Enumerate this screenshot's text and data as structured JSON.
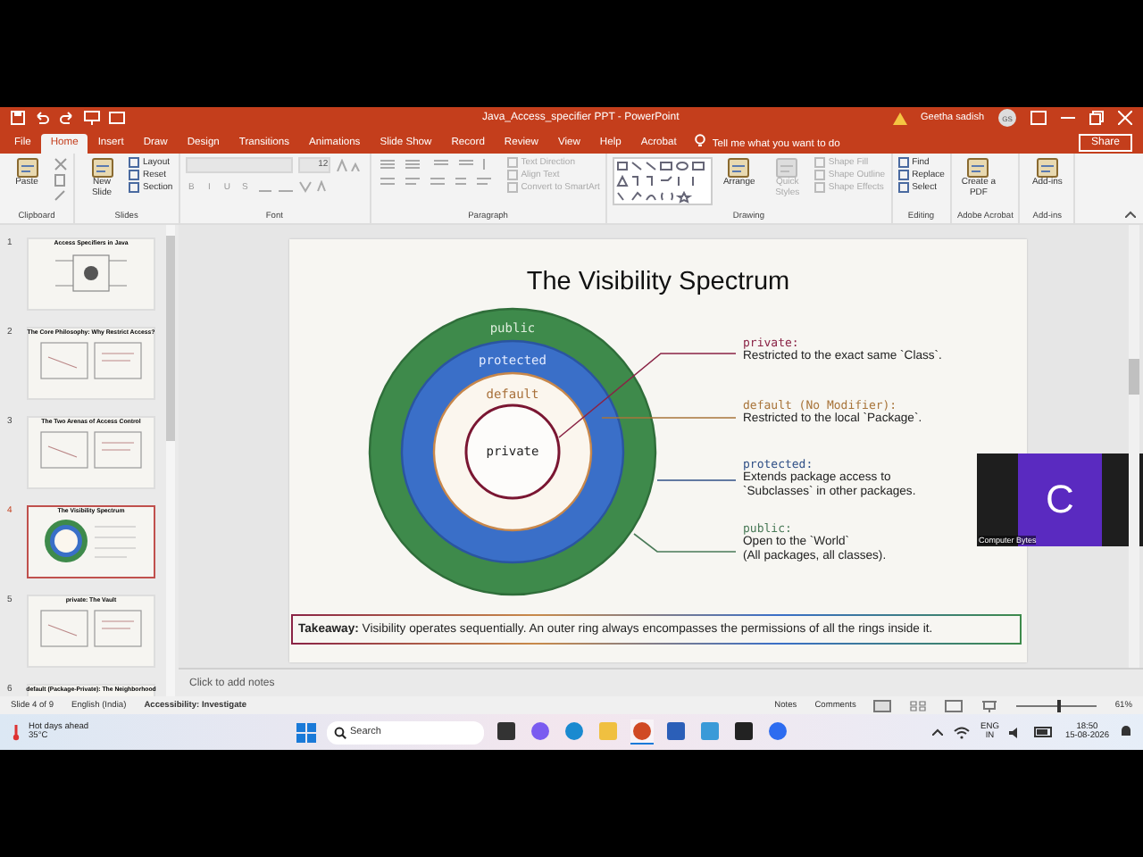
{
  "window": {
    "title": "Java_Access_specifier PPT  -  PowerPoint",
    "user": "Geetha sadish",
    "avatar": "GS"
  },
  "ribbon_tabs": [
    {
      "label": "File",
      "selected": false
    },
    {
      "label": "Home",
      "selected": true
    },
    {
      "label": "Insert",
      "selected": false
    },
    {
      "label": "Draw",
      "selected": false
    },
    {
      "label": "Design",
      "selected": false
    },
    {
      "label": "Transitions",
      "selected": false
    },
    {
      "label": "Animations",
      "selected": false
    },
    {
      "label": "Slide Show",
      "selected": false
    },
    {
      "label": "Record",
      "selected": false
    },
    {
      "label": "Review",
      "selected": false
    },
    {
      "label": "View",
      "selected": false
    },
    {
      "label": "Help",
      "selected": false
    },
    {
      "label": "Acrobat",
      "selected": false
    }
  ],
  "tell_me": {
    "placeholder": "Tell me what you want to do"
  },
  "share_button": "Share",
  "ribbon_groups": [
    {
      "label": "Clipboard",
      "items": [
        {
          "kind": "large",
          "label": "Paste",
          "disabled": false
        },
        {
          "kind": "clip-tools"
        }
      ]
    },
    {
      "label": "Slides",
      "items": [
        {
          "kind": "large",
          "label": "New Slide",
          "disabled": false
        },
        {
          "kind": "small",
          "labels": [
            "Layout",
            "Reset",
            "Section"
          ],
          "disabled": false
        }
      ]
    },
    {
      "label": "Font",
      "items": [
        {
          "kind": "font-tools",
          "size": "12",
          "format": [
            "B",
            "I",
            "U",
            "S"
          ]
        }
      ]
    },
    {
      "label": "Paragraph",
      "items": [
        {
          "kind": "para-tools"
        },
        {
          "kind": "small",
          "labels": [
            "Text Direction",
            "Align Text",
            "Convert to SmartArt"
          ],
          "disabled": true
        }
      ]
    },
    {
      "label": "Drawing",
      "items": [
        {
          "kind": "shapes"
        },
        {
          "kind": "large",
          "label": "Arrange",
          "disabled": false
        },
        {
          "kind": "large",
          "label": "Quick Styles",
          "disabled": true
        },
        {
          "kind": "small",
          "labels": [
            "Shape Fill",
            "Shape Outline",
            "Shape Effects"
          ],
          "disabled": true
        }
      ]
    },
    {
      "label": "Editing",
      "items": [
        {
          "kind": "small",
          "labels": [
            "Find",
            "Replace",
            "Select"
          ],
          "disabled": false
        }
      ]
    },
    {
      "label": "Adobe Acrobat",
      "items": [
        {
          "kind": "large",
          "label": "Create a PDF",
          "disabled": false
        }
      ]
    },
    {
      "label": "Add-ins",
      "items": [
        {
          "kind": "large",
          "label": "Add-ins",
          "disabled": false
        }
      ]
    }
  ],
  "thumbnails": [
    {
      "number": "1",
      "title": "Access Specifiers in Java",
      "kind": "diagram",
      "selected": false
    },
    {
      "number": "2",
      "title": "The Core Philosophy: Why Restrict Access?",
      "kind": "panels",
      "selected": false
    },
    {
      "number": "3",
      "title": "The Two Arenas of Access Control",
      "kind": "panels",
      "selected": false
    },
    {
      "number": "4",
      "title": "The Visibility Spectrum",
      "kind": "rings",
      "selected": true
    },
    {
      "number": "5",
      "title": "private: The Vault",
      "kind": "panels",
      "selected": false
    },
    {
      "number": "6",
      "title": "default (Package-Private): The Neighborhood",
      "kind": "diagram",
      "selected": false
    }
  ],
  "slide": {
    "title": "The Visibility Spectrum",
    "rings": [
      {
        "label": "public",
        "color": "#3e8a4b"
      },
      {
        "label": "protected",
        "color": "#3a6fc8"
      },
      {
        "label": "default",
        "color": "#fbf6ee"
      },
      {
        "label": "private",
        "color": "#fdfcfa"
      }
    ],
    "legend": [
      {
        "keyword": "private:",
        "color": "#8a2345",
        "lines": [
          "Restricted to the exact same `Class`."
        ]
      },
      {
        "keyword": "default (No Modifier):",
        "color": "#a8743a",
        "lines": [
          "Restricted to the local `Package`."
        ]
      },
      {
        "keyword": "protected:",
        "color": "#2f4f86",
        "lines": [
          "Extends package access to",
          "`Subclasses` in other packages."
        ]
      },
      {
        "keyword": "public:",
        "color": "#4a7a58",
        "lines": [
          "Open to the `World`",
          "(All packages, all classes)."
        ]
      }
    ],
    "takeaway": "**Takeaway:** Visibility operates sequentially. An outer ring always encompasses the permissions of all the rings inside it."
  },
  "video": {
    "letter": "C",
    "caption": "Computer Bytes"
  },
  "notes": {
    "placeholder": "Click to add notes"
  },
  "status_bar": {
    "slide": "Slide 4 of 9",
    "language": "English (India)",
    "accessibility": "Accessibility: Investigate",
    "notes": "Notes",
    "comments": "Comments",
    "zoom": "61%",
    "level": 0.5
  },
  "taskbar": {
    "weather": "Hot days ahead",
    "temperature": "35°C",
    "search": {
      "placeholder": "Search"
    },
    "apps": [
      {
        "kind": "store",
        "selected": false
      },
      {
        "kind": "copilot",
        "selected": false
      },
      {
        "kind": "edge",
        "selected": false
      },
      {
        "kind": "folder",
        "selected": false
      },
      {
        "kind": "powerpoint",
        "selected": true
      },
      {
        "kind": "word",
        "selected": false
      },
      {
        "kind": "notepad",
        "selected": false
      },
      {
        "kind": "terminal",
        "selected": false
      },
      {
        "kind": "meet",
        "selected": false
      }
    ],
    "language": [
      "ENG",
      "IN"
    ],
    "time": "18:50",
    "date": "15-08-2026"
  }
}
